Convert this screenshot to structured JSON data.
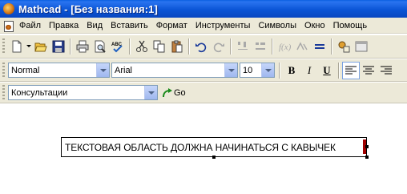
{
  "window": {
    "title": "Mathcad - [Без названия:1]"
  },
  "menubar": {
    "items": [
      "Файл",
      "Правка",
      "Вид",
      "Вставить",
      "Формат",
      "Инструменты",
      "Символы",
      "Окно",
      "Помощь"
    ]
  },
  "standard_toolbar": {
    "buttons": [
      "new-icon",
      "open-icon",
      "save-icon",
      "print-icon",
      "print-preview-icon",
      "spell-check-icon",
      "cut-icon",
      "copy-icon",
      "paste-icon",
      "undo-icon",
      "redo-icon",
      "align-icon",
      "insert-function-icon",
      "equals-icon",
      "resource-icon",
      "component-icon"
    ],
    "spell_label": "ABC"
  },
  "formatting_toolbar": {
    "style": "Normal",
    "font": "Arial",
    "size": "10",
    "bold_label": "B",
    "italic_label": "I",
    "underline_label": "U"
  },
  "resources_toolbar": {
    "selected": "Консультации",
    "go_label": "Go"
  },
  "document": {
    "text_region": "ТЕКСТОВАЯ ОБЛАСТЬ ДОЛЖНА НАЧИНАТЬСЯ С КАВЫЧЕК"
  },
  "colors": {
    "titlebar": "#0b55d6",
    "toolbar_bg": "#ece9d8",
    "caret": "#a00000"
  }
}
